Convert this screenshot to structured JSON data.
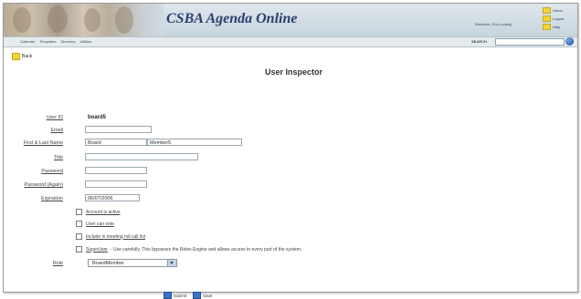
{
  "header": {
    "title": "CSBA Agenda Online",
    "welcome": "Welcome, Erin Ludwig",
    "corner_links": [
      "Home",
      "Logout",
      "Help"
    ]
  },
  "nav": {
    "items": [
      "Calendar",
      "Templates",
      "Directory",
      "Utilities"
    ],
    "search_label": "SEARCH",
    "search_value": ""
  },
  "back_label": "Back",
  "inspector_title": "User Inspector",
  "form": {
    "user_id_label": "User ID",
    "user_id_value": "board5",
    "email_label": "Email",
    "email_value": "",
    "name_label": "First & Last Name",
    "first_name": "Board",
    "last_name": "Member5",
    "title_label": "Title",
    "title_value": "",
    "password_label": "Password",
    "password_value": "",
    "password_again_label": "Password (Again)",
    "password_again_value": "",
    "expiration_label": "Expiration",
    "expiration_value": "06/07/2006",
    "checkbox_active": "Account is active",
    "checkbox_vote": "User can vote",
    "checkbox_rollcall": "Include in meeting roll call list",
    "checkbox_superuser": "SuperUser",
    "superuser_note": "- Use carefully. This bypasses the Roles Engine and allows access to every part of the system.",
    "role_label": "Role",
    "role_value": "BoardMember"
  },
  "buttons": {
    "submit": "Submit",
    "save": "Save"
  }
}
